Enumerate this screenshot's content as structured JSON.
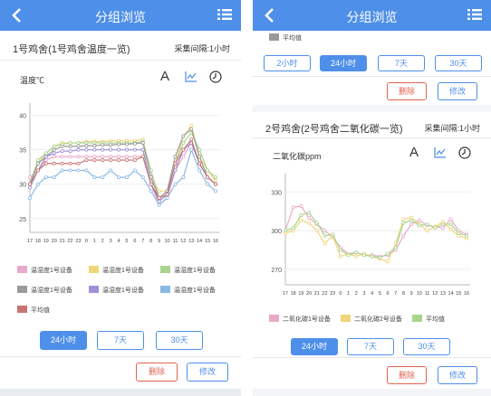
{
  "appbar": {
    "title": "分组浏览",
    "back_icon": "chevron-left-icon",
    "menu_icon": "list-icon",
    "color": "#4e8fe9"
  },
  "left": {
    "group_title": "1号鸡舍(1号鸡舍温度一览)",
    "interval": "采集间隔:1小时",
    "metric_label": "温度℃",
    "tools": {
      "font": "A",
      "chart_icon": "line-chart-icon",
      "clock_icon": "clock-icon"
    },
    "legend": [
      {
        "label": "温湿度1号设备",
        "color": "#e8aac8"
      },
      {
        "label": "温湿度1号设备",
        "color": "#f1d57a"
      },
      {
        "label": "温湿度1号设备",
        "color": "#a9d48e"
      },
      {
        "label": "温湿度1号设备",
        "color": "#9a9a9a"
      },
      {
        "label": "温湿度1号设备",
        "color": "#a18fd9"
      },
      {
        "label": "温湿度1号设备",
        "color": "#8cb9e4"
      },
      {
        "label": "平均值",
        "color": "#c97474"
      }
    ],
    "range_buttons": [
      "24小时",
      "7天",
      "30天"
    ],
    "active_range": "24小时",
    "delete_label": "删除",
    "edit_label": "修改"
  },
  "right": {
    "top_legend": {
      "label": "平均值",
      "color": "#9a9a9a"
    },
    "range_buttons": [
      "2小时",
      "24小时",
      "7天",
      "30天"
    ],
    "active_range": "24小时",
    "delete_label": "删除",
    "edit_label": "修改",
    "group_title": "2号鸡舍(2号鸡舍二氧化碳一览)",
    "interval": "采集间隔:1小时",
    "metric_label": "二氧化碳ppm",
    "tools": {
      "font": "A",
      "chart_icon": "line-chart-icon",
      "clock_icon": "clock-icon"
    },
    "legend": [
      {
        "label": "二氧化碳1号设备",
        "color": "#e8aac8"
      },
      {
        "label": "二氧化碳2号设备",
        "color": "#f1d57a"
      },
      {
        "label": "平均值",
        "color": "#a9d48e"
      }
    ],
    "range_buttons_2": [
      "24小时",
      "7天",
      "30天"
    ],
    "active_range_2": "24小时",
    "delete_label_2": "删除",
    "edit_label_2": "修改"
  },
  "chart_data": [
    {
      "type": "line",
      "categories": [
        "17",
        "18",
        "19",
        "20",
        "21",
        "22",
        "23",
        "0",
        "1",
        "2",
        "3",
        "4",
        "5",
        "6",
        "7",
        "8",
        "9",
        "10",
        "11",
        "12",
        "13",
        "14",
        "15",
        "16"
      ],
      "yticks": [
        25,
        30,
        35,
        40
      ],
      "ylim": [
        23,
        41
      ],
      "grid": true,
      "series": [
        {
          "name": "温湿度1号设备",
          "color": "#e8aac8",
          "values": [
            31,
            32,
            33.5,
            34,
            34,
            34,
            34,
            34,
            34,
            34,
            34,
            34,
            34,
            34,
            34,
            30,
            27,
            28,
            32,
            34,
            36,
            33,
            31,
            30
          ]
        },
        {
          "name": "温湿度1号设备",
          "color": "#f1d57a",
          "values": [
            30,
            33,
            34.5,
            35.5,
            36,
            36,
            36,
            36.2,
            36.2,
            36.2,
            36.3,
            36.3,
            36.3,
            36.3,
            36.5,
            31,
            29,
            29,
            33,
            37,
            38.5,
            34,
            32,
            30.5
          ]
        },
        {
          "name": "温湿度1号设备",
          "color": "#a9d48e",
          "values": [
            30,
            33.5,
            34.5,
            35.5,
            35.8,
            36,
            36,
            36,
            36,
            36,
            36,
            36,
            36,
            36,
            36.2,
            32,
            28,
            29,
            33,
            36,
            37.5,
            35,
            32,
            31
          ]
        },
        {
          "name": "温湿度1号设备",
          "color": "#9a9a9a",
          "values": [
            30,
            33,
            34,
            35,
            35.5,
            35.5,
            35.5,
            35.6,
            35.6,
            35.7,
            35.7,
            35.8,
            35.8,
            35.9,
            36,
            31,
            28,
            29,
            34,
            37,
            38,
            34,
            31,
            30
          ]
        },
        {
          "name": "温湿度1号设备",
          "color": "#a18fd9",
          "values": [
            29.5,
            32,
            34,
            34.5,
            34.8,
            34.8,
            35,
            35,
            35,
            35,
            35,
            35,
            35,
            35,
            35,
            30,
            27.5,
            28.5,
            32,
            35,
            36,
            33,
            31,
            30
          ]
        },
        {
          "name": "温湿度1号设备",
          "color": "#8cb9e4",
          "values": [
            28,
            30,
            31,
            31,
            32,
            32,
            32,
            32,
            31,
            31,
            32,
            31,
            31,
            32,
            31,
            29,
            27,
            28,
            30,
            31,
            35,
            32,
            30,
            29
          ]
        },
        {
          "name": "平均值",
          "color": "#c97474",
          "values": [
            30,
            32,
            33,
            33,
            33,
            33,
            33,
            33.5,
            33.5,
            33.5,
            33.5,
            33.5,
            33.5,
            33.5,
            34,
            30,
            28,
            28.5,
            33,
            35,
            36.5,
            33,
            31,
            30
          ]
        }
      ]
    },
    {
      "type": "line",
      "categories": [
        "17",
        "18",
        "19",
        "20",
        "21",
        "22",
        "23",
        "0",
        "1",
        "2",
        "3",
        "4",
        "5",
        "6",
        "7",
        "8",
        "9",
        "10",
        "11",
        "12",
        "13",
        "14",
        "15",
        "16"
      ],
      "yticks": [
        270,
        300,
        330
      ],
      "ylim": [
        258,
        340
      ],
      "grid": true,
      "series": [
        {
          "name": "二氧化碳1号设备",
          "color": "#e8aac8",
          "values": [
            300,
            318,
            319,
            310,
            305,
            300,
            295,
            287,
            282,
            283,
            281,
            281,
            280,
            281,
            285,
            296,
            305,
            308,
            304,
            303,
            302,
            309,
            300,
            297
          ]
        },
        {
          "name": "二氧化碳2号设备",
          "color": "#f1d57a",
          "values": [
            298,
            300,
            308,
            306,
            300,
            290,
            296,
            280,
            282,
            280,
            282,
            280,
            278,
            276,
            290,
            309,
            310,
            305,
            300,
            303,
            307,
            301,
            296,
            294
          ]
        },
        {
          "name": "平均值",
          "color": "#a9d48e",
          "values": [
            300,
            302,
            312,
            314,
            306,
            296,
            297,
            285,
            281,
            283,
            281,
            280,
            279,
            282,
            287,
            306,
            308,
            304,
            305,
            302,
            305,
            305,
            298,
            296
          ]
        }
      ]
    }
  ]
}
